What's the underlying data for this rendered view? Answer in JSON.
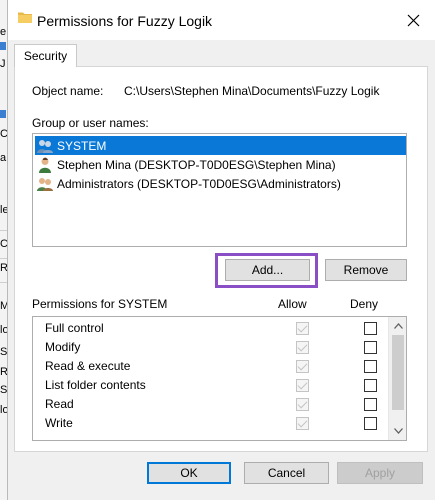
{
  "background_fragments": [
    "e",
    "J",
    "C",
    "a",
    "le",
    "C",
    "R",
    "M",
    "lo",
    "S",
    "R",
    "S",
    "lo"
  ],
  "dialog": {
    "title": "Permissions for Fuzzy Logik",
    "close_glyph": "✕",
    "tab_label": "Security"
  },
  "object": {
    "label": "Object name:",
    "value": "C:\\Users\\Stephen Mina\\Documents\\Fuzzy Logik"
  },
  "groups": {
    "label": "Group or user names:",
    "items": [
      {
        "name": "SYSTEM",
        "selected": true
      },
      {
        "name": "Stephen Mina (DESKTOP-T0D0ESG\\Stephen Mina)",
        "selected": false
      },
      {
        "name": "Administrators (DESKTOP-T0D0ESG\\Administrators)",
        "selected": false
      }
    ]
  },
  "buttons": {
    "add": "Add...",
    "remove": "Remove",
    "ok": "OK",
    "cancel": "Cancel",
    "apply": "Apply"
  },
  "permissions": {
    "label": "Permissions for SYSTEM",
    "allow_header": "Allow",
    "deny_header": "Deny",
    "rows": [
      {
        "name": "Full control",
        "allow": true,
        "deny": false
      },
      {
        "name": "Modify",
        "allow": true,
        "deny": false
      },
      {
        "name": "Read & execute",
        "allow": true,
        "deny": false
      },
      {
        "name": "List folder contents",
        "allow": true,
        "deny": false
      },
      {
        "name": "Read",
        "allow": true,
        "deny": false
      },
      {
        "name": "Write",
        "allow": true,
        "deny": false
      }
    ]
  },
  "colors": {
    "selection": "#0a78d7",
    "highlight_box": "#8a4fc4",
    "primary_border": "#0078d7"
  }
}
